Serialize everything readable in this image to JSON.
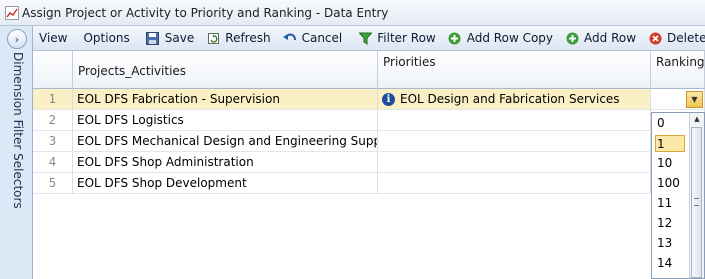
{
  "window": {
    "title": "Assign Project or Activity to Priority and Ranking - Data Entry"
  },
  "side_panel": {
    "label": "Dimension Filter Selectors",
    "expand_glyph": "›"
  },
  "toolbar": {
    "view": "View",
    "options": "Options",
    "save": "Save",
    "refresh": "Refresh",
    "cancel": "Cancel",
    "filter_row": "Filter Row",
    "add_row_copy": "Add Row Copy",
    "add_row": "Add Row",
    "delete": "Delete"
  },
  "grid": {
    "columns": {
      "projects": "Projects_Activities",
      "priorities": "Priorities",
      "ranking": "Ranking"
    },
    "rows": [
      {
        "num": "1",
        "project": "EOL DFS Fabrication - Supervision",
        "priority": "EOL Design and Fabrication Services",
        "ranking": ""
      },
      {
        "num": "2",
        "project": "EOL DFS Logistics",
        "priority": "",
        "ranking": ""
      },
      {
        "num": "3",
        "project": "EOL DFS Mechanical Design and Engineering Support",
        "priority": "",
        "ranking": ""
      },
      {
        "num": "4",
        "project": "EOL DFS Shop Administration",
        "priority": "",
        "ranking": ""
      },
      {
        "num": "5",
        "project": "EOL DFS Shop Development",
        "priority": "",
        "ranking": ""
      }
    ],
    "selected_row": "1"
  },
  "ranking_dropdown": {
    "options": [
      "0",
      "1",
      "10",
      "100",
      "11",
      "12",
      "13",
      "14"
    ],
    "highlighted": "1"
  },
  "colors": {
    "selected_row": "#fbf0c5",
    "highlight": "#fbe8a8",
    "panel": "#dde8f6"
  },
  "icons": {
    "save": "floppy-disk-icon",
    "refresh": "refresh-icon",
    "cancel": "undo-icon",
    "filter_row": "funnel-icon",
    "add_row_copy": "plus-circle-icon",
    "add_row": "plus-circle-icon",
    "delete": "x-circle-icon",
    "info": "info-icon"
  }
}
